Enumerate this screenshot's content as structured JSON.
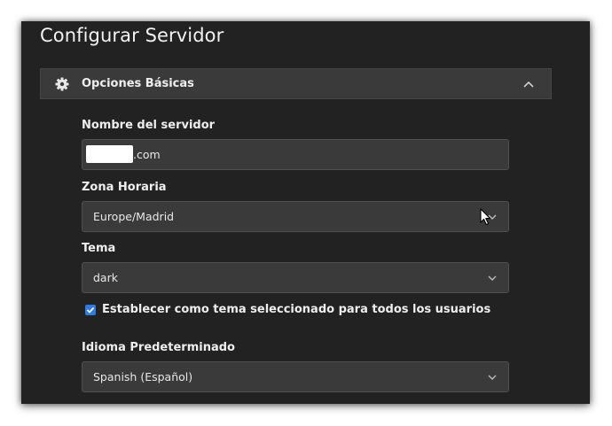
{
  "window": {
    "title": "Configurar Servidor"
  },
  "section": {
    "label": "Opciones Básicas",
    "icon": "gear-icon",
    "toggle_icon": "chevron-up-icon",
    "expanded": true
  },
  "fields": {
    "server_name": {
      "label": "Nombre del servidor",
      "value_visible": ".com",
      "redacted": true
    },
    "timezone": {
      "label": "Zona Horaria",
      "value": "Europe/Madrid"
    },
    "theme": {
      "label": "Tema",
      "value": "dark",
      "apply_all_label": "Establecer como tema seleccionado para todos los usuarios",
      "apply_all_checked": true
    },
    "language": {
      "label": "Idioma Predeterminado",
      "value": "Spanish (Español)"
    }
  },
  "colors": {
    "background": "#222222",
    "panel": "#3a3a3a",
    "text": "#eeeeee",
    "accent": "#2f7de1"
  }
}
